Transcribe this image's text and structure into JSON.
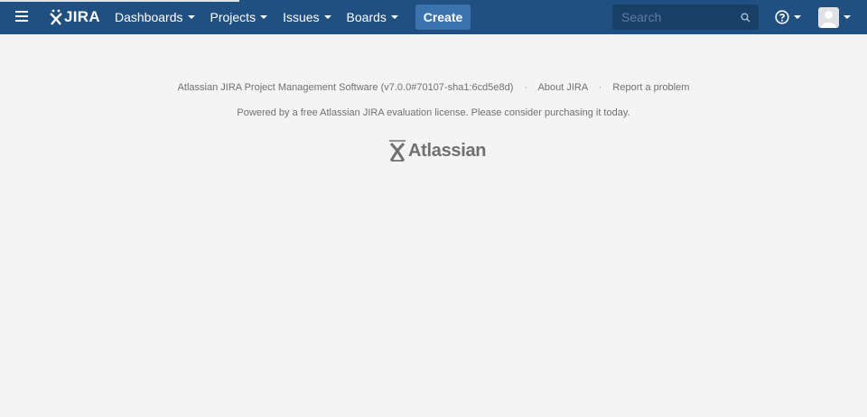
{
  "header": {
    "logo_text": "JIRA",
    "nav": [
      {
        "label": "Dashboards"
      },
      {
        "label": "Projects"
      },
      {
        "label": "Issues"
      },
      {
        "label": "Boards"
      }
    ],
    "create_label": "Create",
    "search_placeholder": "Search",
    "colors": {
      "bar": "#205081",
      "create": "#3b73af",
      "search_bg": "#1a3f67"
    },
    "icons": {
      "menu": "hamburger-icon",
      "logo": "jira-logo-icon",
      "search": "search-icon",
      "help": "help-icon",
      "user": "user-avatar-icon"
    }
  },
  "footer": {
    "software": "Atlassian JIRA Project Management Software (v7.0.0#70107-sha1:6cd5e8d)",
    "sep": "·",
    "about": "About JIRA",
    "report": "Report a problem",
    "license": "Powered by a free Atlassian JIRA evaluation license. Please consider purchasing it today.",
    "brand": "Atlassian"
  }
}
